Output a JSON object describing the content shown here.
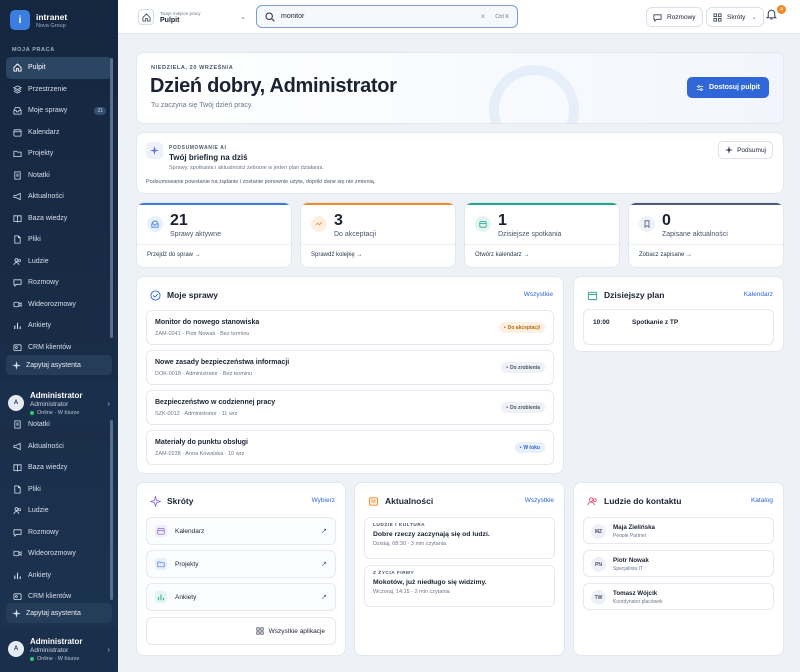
{
  "brand": {
    "logo_letter": "i",
    "name": "intranet",
    "org": "Nova Group"
  },
  "sidebar": {
    "section": "MOJA PRACA",
    "items": [
      {
        "label": "Pulpit",
        "icon": "home-icon",
        "active": true
      },
      {
        "label": "Przestrzenie",
        "icon": "layers-icon"
      },
      {
        "label": "Moje sprawy",
        "icon": "inbox-icon",
        "badge": "21"
      },
      {
        "label": "Kalendarz",
        "icon": "calendar-icon"
      },
      {
        "label": "Projekty",
        "icon": "folder-icon"
      },
      {
        "label": "Notatki",
        "icon": "note-icon"
      },
      {
        "label": "Aktualności",
        "icon": "megaphone-icon"
      },
      {
        "label": "Baza wiedzy",
        "icon": "book-icon"
      },
      {
        "label": "Pliki",
        "icon": "file-icon"
      },
      {
        "label": "Ludzie",
        "icon": "people-icon"
      },
      {
        "label": "Rozmowy",
        "icon": "chat-icon"
      },
      {
        "label": "Wideorozmowy",
        "icon": "video-icon"
      },
      {
        "label": "Ankiety",
        "icon": "poll-icon"
      },
      {
        "label": "CRM klientów",
        "icon": "crm-icon"
      }
    ],
    "items2": [
      {
        "label": "Notatki",
        "icon": "note-icon"
      },
      {
        "label": "Aktualności",
        "icon": "megaphone-icon"
      },
      {
        "label": "Baza wiedzy",
        "icon": "book-icon"
      },
      {
        "label": "Pliki",
        "icon": "file-icon"
      },
      {
        "label": "Ludzie",
        "icon": "people-icon"
      },
      {
        "label": "Rozmowy",
        "icon": "chat-icon"
      },
      {
        "label": "Wideorozmowy",
        "icon": "video-icon"
      },
      {
        "label": "Ankiety",
        "icon": "poll-icon"
      },
      {
        "label": "CRM klientów",
        "icon": "crm-icon"
      }
    ],
    "assistant": "Zapytaj asystenta",
    "user": {
      "initial": "A",
      "name": "Administrator",
      "role": "Administrator",
      "status": "Online · W biurze"
    }
  },
  "topbar": {
    "workspace_label": "Twoje miejsce pracy",
    "workspace_value": "Pulpit",
    "search_value": "monitor",
    "search_kbd": "Ctrl K",
    "chats": "Rozmowy",
    "shortcuts": "Skróty",
    "notif_count": "4"
  },
  "hero": {
    "date": "NIEDZIELA, 20 WRZEŚNIA",
    "title": "Dzień dobry, Administrator",
    "subtitle": "Tu zaczyna się Twój dzień pracy.",
    "button": "Dostosuj pulpit"
  },
  "ai": {
    "kicker": "PODSUMOWANIE AI",
    "title": "Twój briefing na dziś",
    "subtitle": "Sprawy, spotkania i aktualności zebrane w jeden plan działania.",
    "note": "Podsumowanie powstanie na żądanie i zostanie ponownie użyte, dopóki dane się nie zmienią.",
    "button": "Podsumuj"
  },
  "stats": [
    {
      "value": "21",
      "label": "Sprawy aktywne",
      "link": "Przejdź do spraw",
      "color": "#3b7dde",
      "bg": "#e8f0fc"
    },
    {
      "value": "3",
      "label": "Do akceptacji",
      "link": "Sprawdź kolejkę",
      "color": "#f08a24",
      "bg": "#fdf0e2"
    },
    {
      "value": "1",
      "label": "Dzisiejsze spotkania",
      "link": "Otwórz kalendarz",
      "color": "#1fa58a",
      "bg": "#e3f5f0"
    },
    {
      "value": "0",
      "label": "Zapisane aktualności",
      "link": "Zobacz zapisane",
      "color": "#4a5b78",
      "bg": "#eef1f6"
    }
  ],
  "cases": {
    "title": "Moje sprawy",
    "link": "Wszystkie",
    "rows": [
      {
        "title": "Monitor do nowego stanowiska",
        "meta": "ZAM-0241 · Piotr Nowak · Bez terminu",
        "status": "Do akceptacji",
        "fg": "#b26a12",
        "bg": "#fdf0e0"
      },
      {
        "title": "Nowe zasady bezpieczeństwa informacji",
        "meta": "DOK-0018 · Administrator · Bez terminu",
        "status": "Do zrobienia",
        "fg": "#4a5568",
        "bg": "#eef1f6"
      },
      {
        "title": "Bezpieczeństwo w codziennej pracy",
        "meta": "SZK-0012 · Administrator · 11 wrz",
        "status": "Do zrobienia",
        "fg": "#4a5568",
        "bg": "#eef1f6"
      },
      {
        "title": "Materiały do punktu obsługi",
        "meta": "ZAM-0238 · Anna Kowalska · 10 wrz",
        "status": "W toku",
        "fg": "#2f66d8",
        "bg": "#e8f0fc"
      }
    ]
  },
  "plan": {
    "title": "Dzisiejszy plan",
    "link": "Kalendarz",
    "time": "10:00",
    "event": "Spotkanie z TP"
  },
  "shortcuts": {
    "title": "Skróty",
    "link": "Wybierz",
    "items": [
      {
        "label": "Kalendarz",
        "icon": "calendar-icon",
        "color": "#8a63d2",
        "bg": "#f1ecfb"
      },
      {
        "label": "Projekty",
        "icon": "folder-icon",
        "color": "#3b7dde",
        "bg": "#e8f0fc"
      },
      {
        "label": "Ankiety",
        "icon": "poll-icon",
        "color": "#1fa58a",
        "bg": "#e3f5f0"
      }
    ],
    "all": "Wszystkie aplikacje"
  },
  "news": {
    "title": "Aktualności",
    "link": "Wszystkie",
    "items": [
      {
        "kicker": "LUDZIE I KULTURA",
        "title": "Dobre rzeczy zaczynają się od ludzi.",
        "meta": "Dzisiaj, 08:30 · 3 min czytania"
      },
      {
        "kicker": "Z ŻYCIA FIRMY",
        "title": "Mokotów, już niedługo się widzimy.",
        "meta": "Wczoraj, 14:15 · 2 min czytania"
      }
    ]
  },
  "contacts": {
    "title": "Ludzie do kontaktu",
    "link": "Katalog",
    "items": [
      {
        "initials": "MZ",
        "name": "Maja Zielińska",
        "role": "People Partner"
      },
      {
        "initials": "PN",
        "name": "Piotr Nowak",
        "role": "Specjalista IT"
      },
      {
        "initials": "TW",
        "name": "Tomasz Wójcik",
        "role": "Koordynator placówek"
      }
    ]
  }
}
